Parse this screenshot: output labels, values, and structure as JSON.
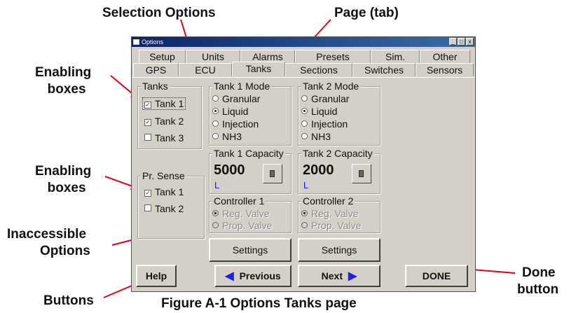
{
  "callouts": {
    "selection_options": "Selection Options",
    "page_tab": "Page (tab)",
    "enabling_boxes_1": [
      "Enabling",
      "boxes"
    ],
    "enabling_boxes_2": [
      "Enabling",
      "boxes"
    ],
    "inaccessible_options": [
      "Inaccessible",
      "Options"
    ],
    "buttons": "Buttons",
    "done_button": [
      "Done",
      "button"
    ]
  },
  "window": {
    "title": "Options",
    "controls": [
      "_",
      "□",
      "x"
    ]
  },
  "tabs_row1": [
    "Setup",
    "Units",
    "Alarms",
    "Presets",
    "Sim.",
    "Other"
  ],
  "tabs_row2": [
    "GPS",
    "ECU",
    "Tanks",
    "Sections",
    "Switches",
    "Sensors"
  ],
  "active_tab": "Tanks",
  "tanks_group": {
    "title": "Tanks",
    "items": [
      {
        "label": "Tank 1",
        "checked": true
      },
      {
        "label": "Tank 2",
        "checked": true
      },
      {
        "label": "Tank 3",
        "checked": false
      }
    ]
  },
  "tank1_mode": {
    "title": "Tank 1 Mode",
    "options": [
      "Granular",
      "Liquid",
      "Injection",
      "NH3"
    ],
    "selected": "Liquid"
  },
  "tank2_mode": {
    "title": "Tank 2 Mode",
    "options": [
      "Granular",
      "Liquid",
      "Injection",
      "NH3"
    ],
    "selected": "Liquid"
  },
  "tank1_capacity": {
    "title": "Tank 1 Capacity",
    "value": "5000",
    "unit": "L"
  },
  "tank2_capacity": {
    "title": "Tank 2 Capacity",
    "value": "2000",
    "unit": "L"
  },
  "pr_sense": {
    "title": "Pr. Sense",
    "items": [
      {
        "label": "Tank 1",
        "checked": true
      },
      {
        "label": "Tank 2",
        "checked": false
      }
    ]
  },
  "controller1": {
    "title": "Controller 1",
    "options": [
      "Reg. Valve",
      "Prop. Valve"
    ],
    "selected": "Reg. Valve"
  },
  "controller2": {
    "title": "Controller 2",
    "options": [
      "Reg. Valve",
      "Prop. Valve"
    ],
    "selected": "Reg. Valve"
  },
  "settings_label": "Settings",
  "bottom_buttons": {
    "help": "Help",
    "previous": "Previous",
    "next": "Next",
    "done": "DONE"
  },
  "caption": "Figure A-1  Options  Tanks page",
  "colors": {
    "window_bg": "#d4d0c8",
    "unit_blue": "#1a1ae0",
    "arrow_blue": "#1f1fe6",
    "callout_line": "#e3000f"
  }
}
